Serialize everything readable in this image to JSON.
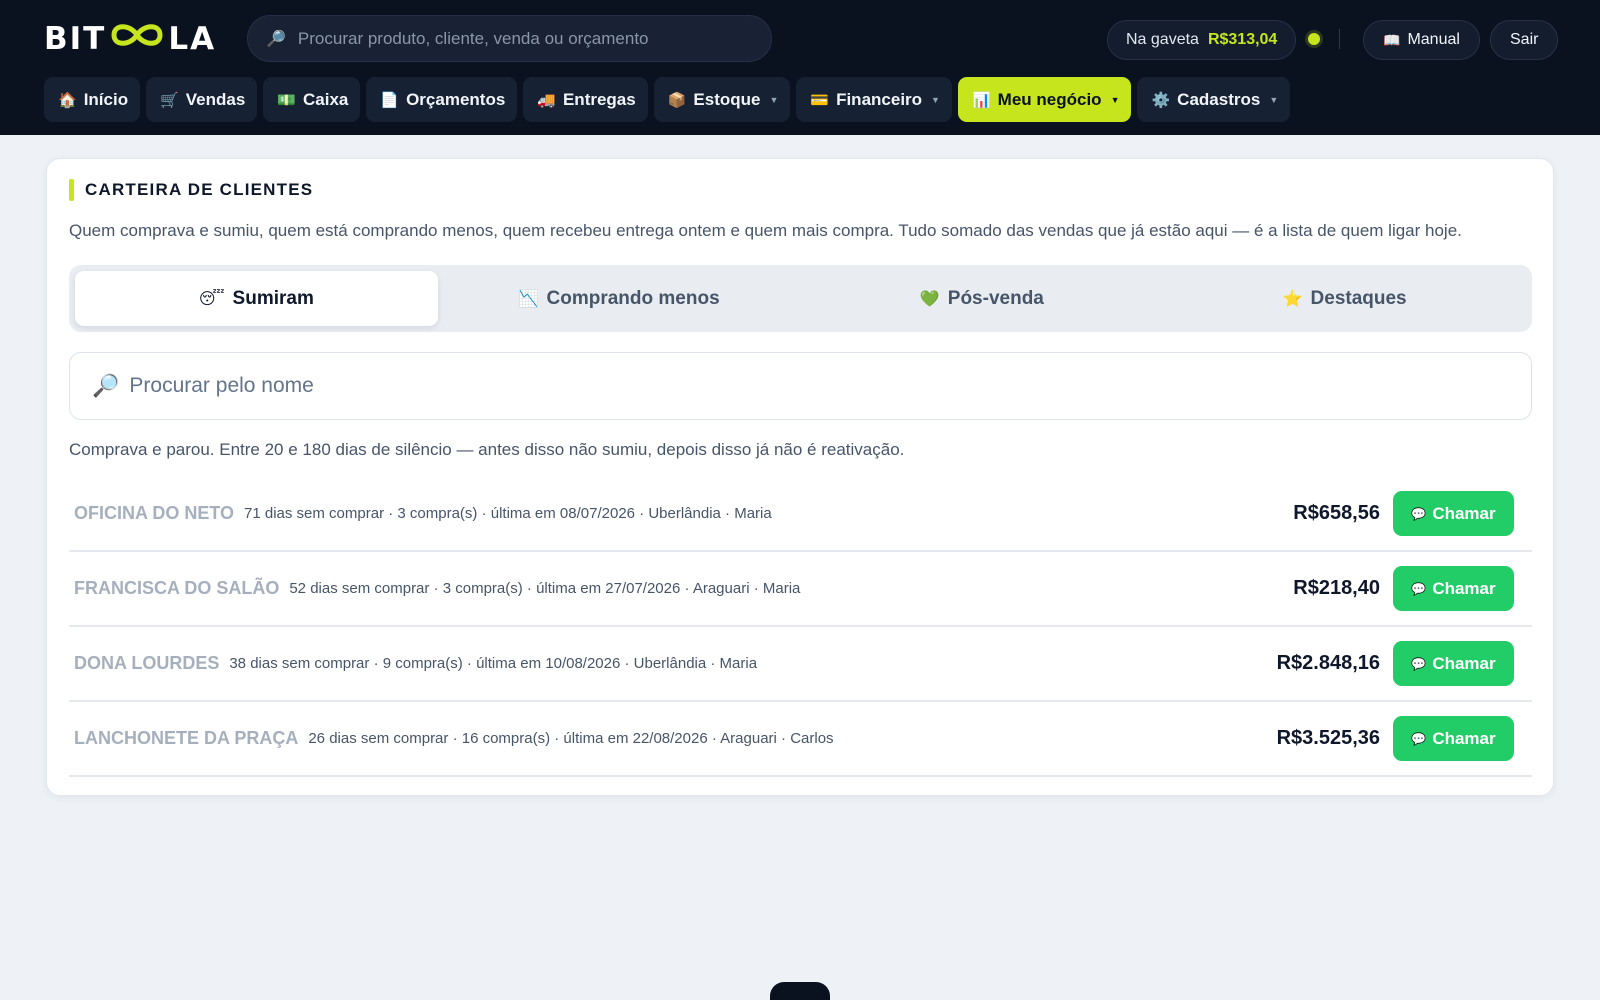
{
  "header": {
    "logo_left": "BIT",
    "logo_right": "LA",
    "search_placeholder": "Procurar produto, cliente, venda ou orçamento",
    "drawer_label": "Na gaveta",
    "drawer_amount": "R$313,04",
    "manual_label": "Manual",
    "logout_label": "Sair",
    "accent_color": "#c6e51c"
  },
  "nav": [
    {
      "icon": "house-icon",
      "glyph": "🏠",
      "label": "Início"
    },
    {
      "icon": "cart-icon",
      "glyph": "🛒",
      "label": "Vendas"
    },
    {
      "icon": "cash-icon",
      "glyph": "💵",
      "label": "Caixa"
    },
    {
      "icon": "document-icon",
      "glyph": "📄",
      "label": "Orçamentos"
    },
    {
      "icon": "truck-icon",
      "glyph": "🚚",
      "label": "Entregas"
    },
    {
      "icon": "box-icon",
      "glyph": "📦",
      "label": "Estoque"
    },
    {
      "icon": "card-icon",
      "glyph": "💳",
      "label": "Financeiro"
    },
    {
      "icon": "chart-icon",
      "glyph": "📊",
      "label": "Meu negócio"
    },
    {
      "icon": "gear-icon",
      "glyph": "⚙️",
      "label": "Cadastros"
    }
  ],
  "card": {
    "title": "CARTEIRA DE CLIENTES",
    "description": "Quem comprava e sumiu, quem está comprando menos, quem recebeu entrega ontem e quem mais compra. Tudo somado das vendas que já estão aqui — é a lista de quem ligar hoje.",
    "tabs": [
      {
        "icon": "sleeping-face-icon",
        "glyph": "😴",
        "label": "Sumiram"
      },
      {
        "icon": "chart-down-icon",
        "glyph": "📉",
        "label": "Comprando menos"
      },
      {
        "icon": "green-heart-icon",
        "glyph": "💚",
        "label": "Pós-venda"
      },
      {
        "icon": "star-icon",
        "glyph": "⭐",
        "label": "Destaques"
      }
    ],
    "search_placeholder": "Procurar pelo nome",
    "hint": "Comprava e parou. Entre 20 e 180 dias de silêncio — antes disso não sumiu, depois disso já não é reativação.",
    "call_label": "Chamar",
    "customers": [
      {
        "name": "OFICINA DO NETO",
        "meta": "71 dias sem comprar · 3 compra(s) · última em 08/07/2026 · Uberlândia · Maria",
        "value": "R$658,56"
      },
      {
        "name": "FRANCISCA DO SALÃO",
        "meta": "52 dias sem comprar · 3 compra(s) · última em 27/07/2026 · Araguari · Maria",
        "value": "R$218,40"
      },
      {
        "name": "DONA LOURDES",
        "meta": "38 dias sem comprar · 9 compra(s) · última em 10/08/2026 · Uberlândia · Maria",
        "value": "R$2.848,16"
      },
      {
        "name": "LANCHONETE DA PRAÇA",
        "meta": "26 dias sem comprar · 16 compra(s) · última em 22/08/2026 · Araguari · Carlos",
        "value": "R$3.525,36"
      }
    ]
  }
}
